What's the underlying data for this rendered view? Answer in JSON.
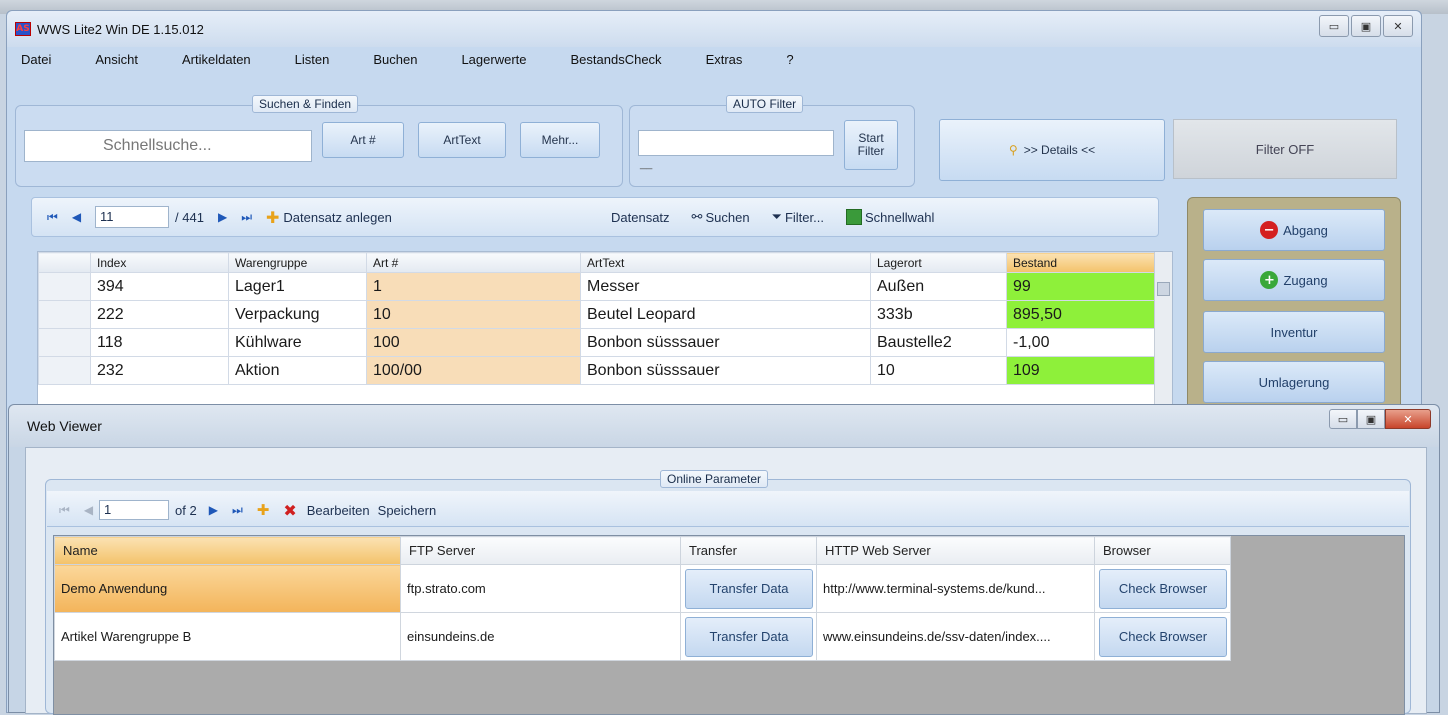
{
  "app": {
    "title": "WWS Lite2 Win DE 1.15.012",
    "logo": "AS"
  },
  "window_buttons": {
    "minimize": "▭",
    "maximize": "▣",
    "close": "✕"
  },
  "menu": [
    "Datei",
    "Ansicht",
    "Artikeldaten",
    "Listen",
    "Buchen",
    "Lagerwerte",
    "BestandsCheck",
    "Extras",
    "?"
  ],
  "search": {
    "legend": "Suchen & Finden",
    "placeholder": "Schnellsuche...",
    "btn_art": "Art #",
    "btn_arttext": "ArtText",
    "btn_more": "Mehr..."
  },
  "autofilter": {
    "legend": "AUTO Filter",
    "start_line1": "Start",
    "start_line2": "Filter",
    "dash": "__"
  },
  "details_button": ">> Details <<",
  "filter_off": "Filter OFF",
  "nav": {
    "current": "11",
    "total": "/ 441",
    "add": "Datensatz anlegen",
    "datensatz": "Datensatz",
    "suchen": "Suchen",
    "filter": "Filter...",
    "schnellwahl": "Schnellwahl"
  },
  "grid": {
    "columns": [
      "Index",
      "Warengruppe",
      "Art #",
      "ArtText",
      "Lagerort",
      "Bestand"
    ],
    "rows": [
      [
        "394",
        "Lager1",
        "1",
        "Messer",
        "Außen",
        "99"
      ],
      [
        "222",
        "Verpackung",
        "10",
        "Beutel Leopard",
        "333b",
        "895,50"
      ],
      [
        "118",
        "Kühlware",
        "100",
        "Bonbon süsssauer",
        "Baustelle2",
        "-1,00"
      ],
      [
        "232",
        "Aktion",
        "100/00",
        "Bonbon süsssauer",
        "10",
        "109"
      ]
    ]
  },
  "actions": {
    "abgang": "Abgang",
    "zugang": "Zugang",
    "inventur": "Inventur",
    "umlagerung": "Umlagerung"
  },
  "colors": {
    "green": "#8ef03a",
    "orange": "#f8ddb8",
    "header_orange": "#f6c266"
  },
  "webviewer": {
    "title": "Web Viewer",
    "legend": "Online Parameter",
    "nav_current": "1",
    "nav_total": "of 2",
    "edit": "Bearbeiten",
    "save": "Speichern",
    "columns": [
      "Name",
      "FTP Server",
      "Transfer",
      "HTTP Web Server",
      "Browser"
    ],
    "rows": [
      {
        "name": "Demo Anwendung",
        "ftp": "ftp.strato.com",
        "transfer": "Transfer Data",
        "http": "http://www.terminal-systems.de/kund...",
        "browser": "Check Browser"
      },
      {
        "name": "Artikel Warengruppe B",
        "ftp": "einsundeins.de",
        "transfer": "Transfer Data",
        "http": "www.einsundeins.de/ssv-daten/index....",
        "browser": "Check Browser"
      }
    ]
  }
}
